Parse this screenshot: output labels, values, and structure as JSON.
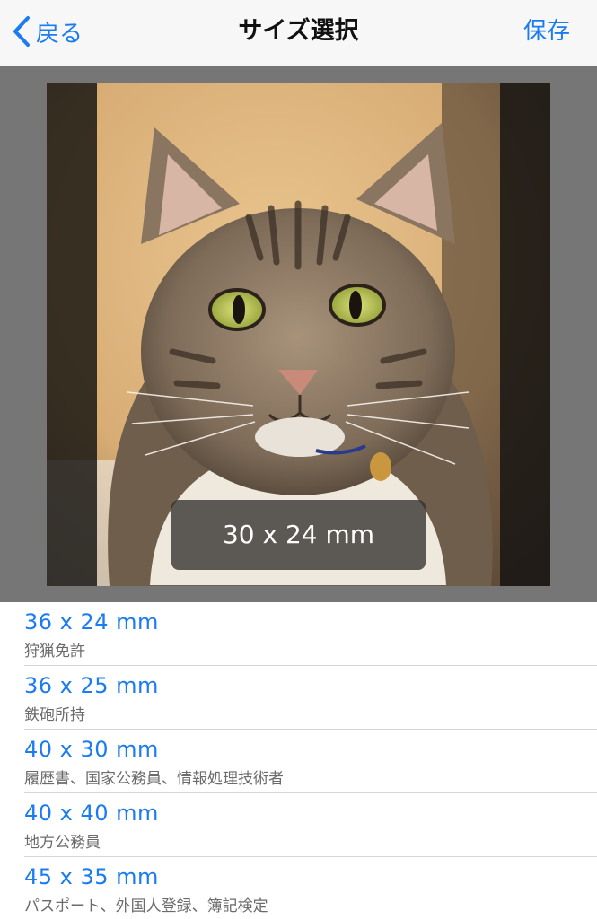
{
  "navbar": {
    "back_label": "戻る",
    "title": "サイズ選択",
    "save_label": "保存"
  },
  "preview": {
    "size_label": "30 x 24 mm"
  },
  "sizes": [
    {
      "size": "36 x 24 mm",
      "usage": "狩猟免許"
    },
    {
      "size": "36 x 25 mm",
      "usage": "鉄砲所持"
    },
    {
      "size": "40 x 30 mm",
      "usage": "履歴書、国家公務員、情報処理技術者"
    },
    {
      "size": "40 x 40 mm",
      "usage": "地方公務員"
    },
    {
      "size": "45 x 35 mm",
      "usage": "パスポート、外国人登録、簿記検定"
    }
  ],
  "colors": {
    "accent": "#1a7cf0",
    "navbar_bg": "#f7f7f7",
    "preview_bg": "#767676"
  }
}
